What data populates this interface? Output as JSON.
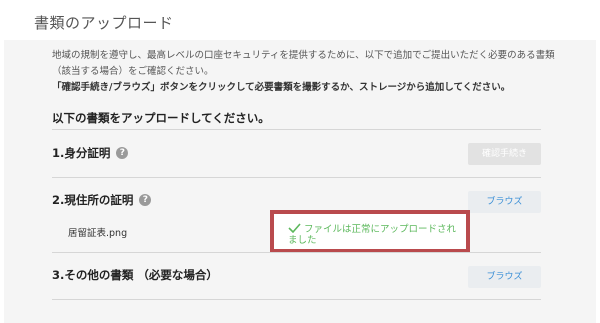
{
  "page": {
    "title": "書類のアップロード"
  },
  "intro": {
    "line1": "地域の規制を遵守し、最高レベルの口座セキュリティを提供するために、以下で追加でご提出いただく必要のある書類",
    "line2": "（該当する場合）をご確認ください。",
    "line3": "「確認手続き/ブラウズ」ボタンをクリックして必要書類を撮影するか、ストレージから追加してください。"
  },
  "upload_heading": "以下の書類をアップロードしてください。",
  "documents": [
    {
      "title": "1.身分証明",
      "help_icon": "question-mark",
      "button_label": "確認手続き",
      "button_state": "disabled"
    },
    {
      "title": "2.現住所の証明",
      "help_icon": "question-mark",
      "button_label": "ブラウズ",
      "file_name": "居留証表.png",
      "status_icon": "check",
      "status_message": "ファイルは正常にアップロードされました"
    },
    {
      "title": "3.その他の書類 （必要な場合）",
      "button_label": "ブラウズ"
    }
  ],
  "colors": {
    "panel_background": "#f5f5f5",
    "link_blue": "#3b8fd6",
    "success_green": "#5cb85c",
    "highlight_border": "#b94a4d"
  }
}
